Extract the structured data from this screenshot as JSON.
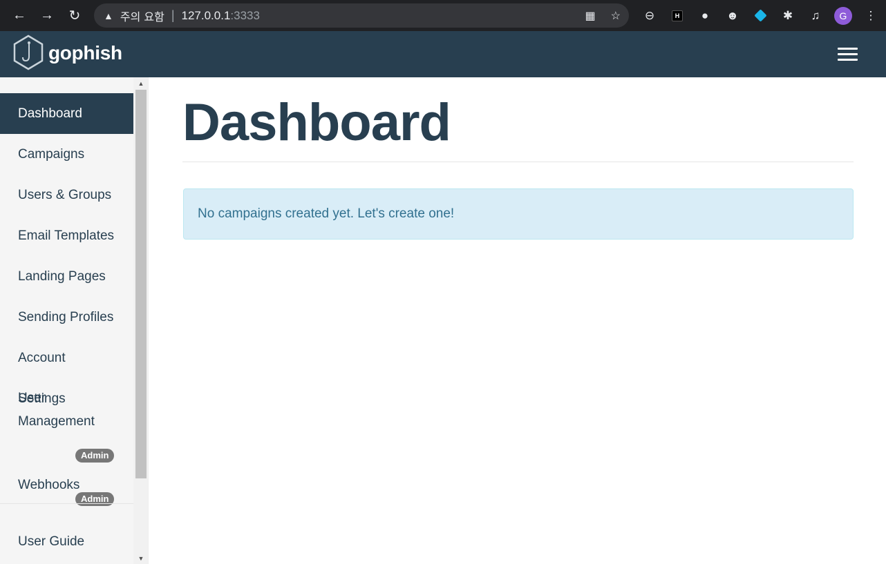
{
  "browser": {
    "security_label": "주의 요함",
    "url_host": "127.0.0.1",
    "url_port": ":3333",
    "profile_initial": "G",
    "ext_h_label": "H"
  },
  "app": {
    "brand_name": "gophish"
  },
  "sidebar": {
    "items": [
      {
        "label": "Dashboard"
      },
      {
        "label": "Campaigns"
      },
      {
        "label": "Users & Groups"
      },
      {
        "label": "Email Templates"
      },
      {
        "label": "Landing Pages"
      },
      {
        "label": "Sending Profiles"
      },
      {
        "label": "Account Settings"
      },
      {
        "label": "User Management",
        "badge": "Admin"
      },
      {
        "label": "Webhooks",
        "badge": "Admin"
      }
    ],
    "guide_label": "User Guide"
  },
  "main": {
    "title": "Dashboard",
    "alert_text": "No campaigns created yet. Let's create one!"
  },
  "colors": {
    "navbar": "#283f50",
    "alert_bg": "#d9edf7",
    "alert_text": "#31708f",
    "badge": "#777777"
  }
}
